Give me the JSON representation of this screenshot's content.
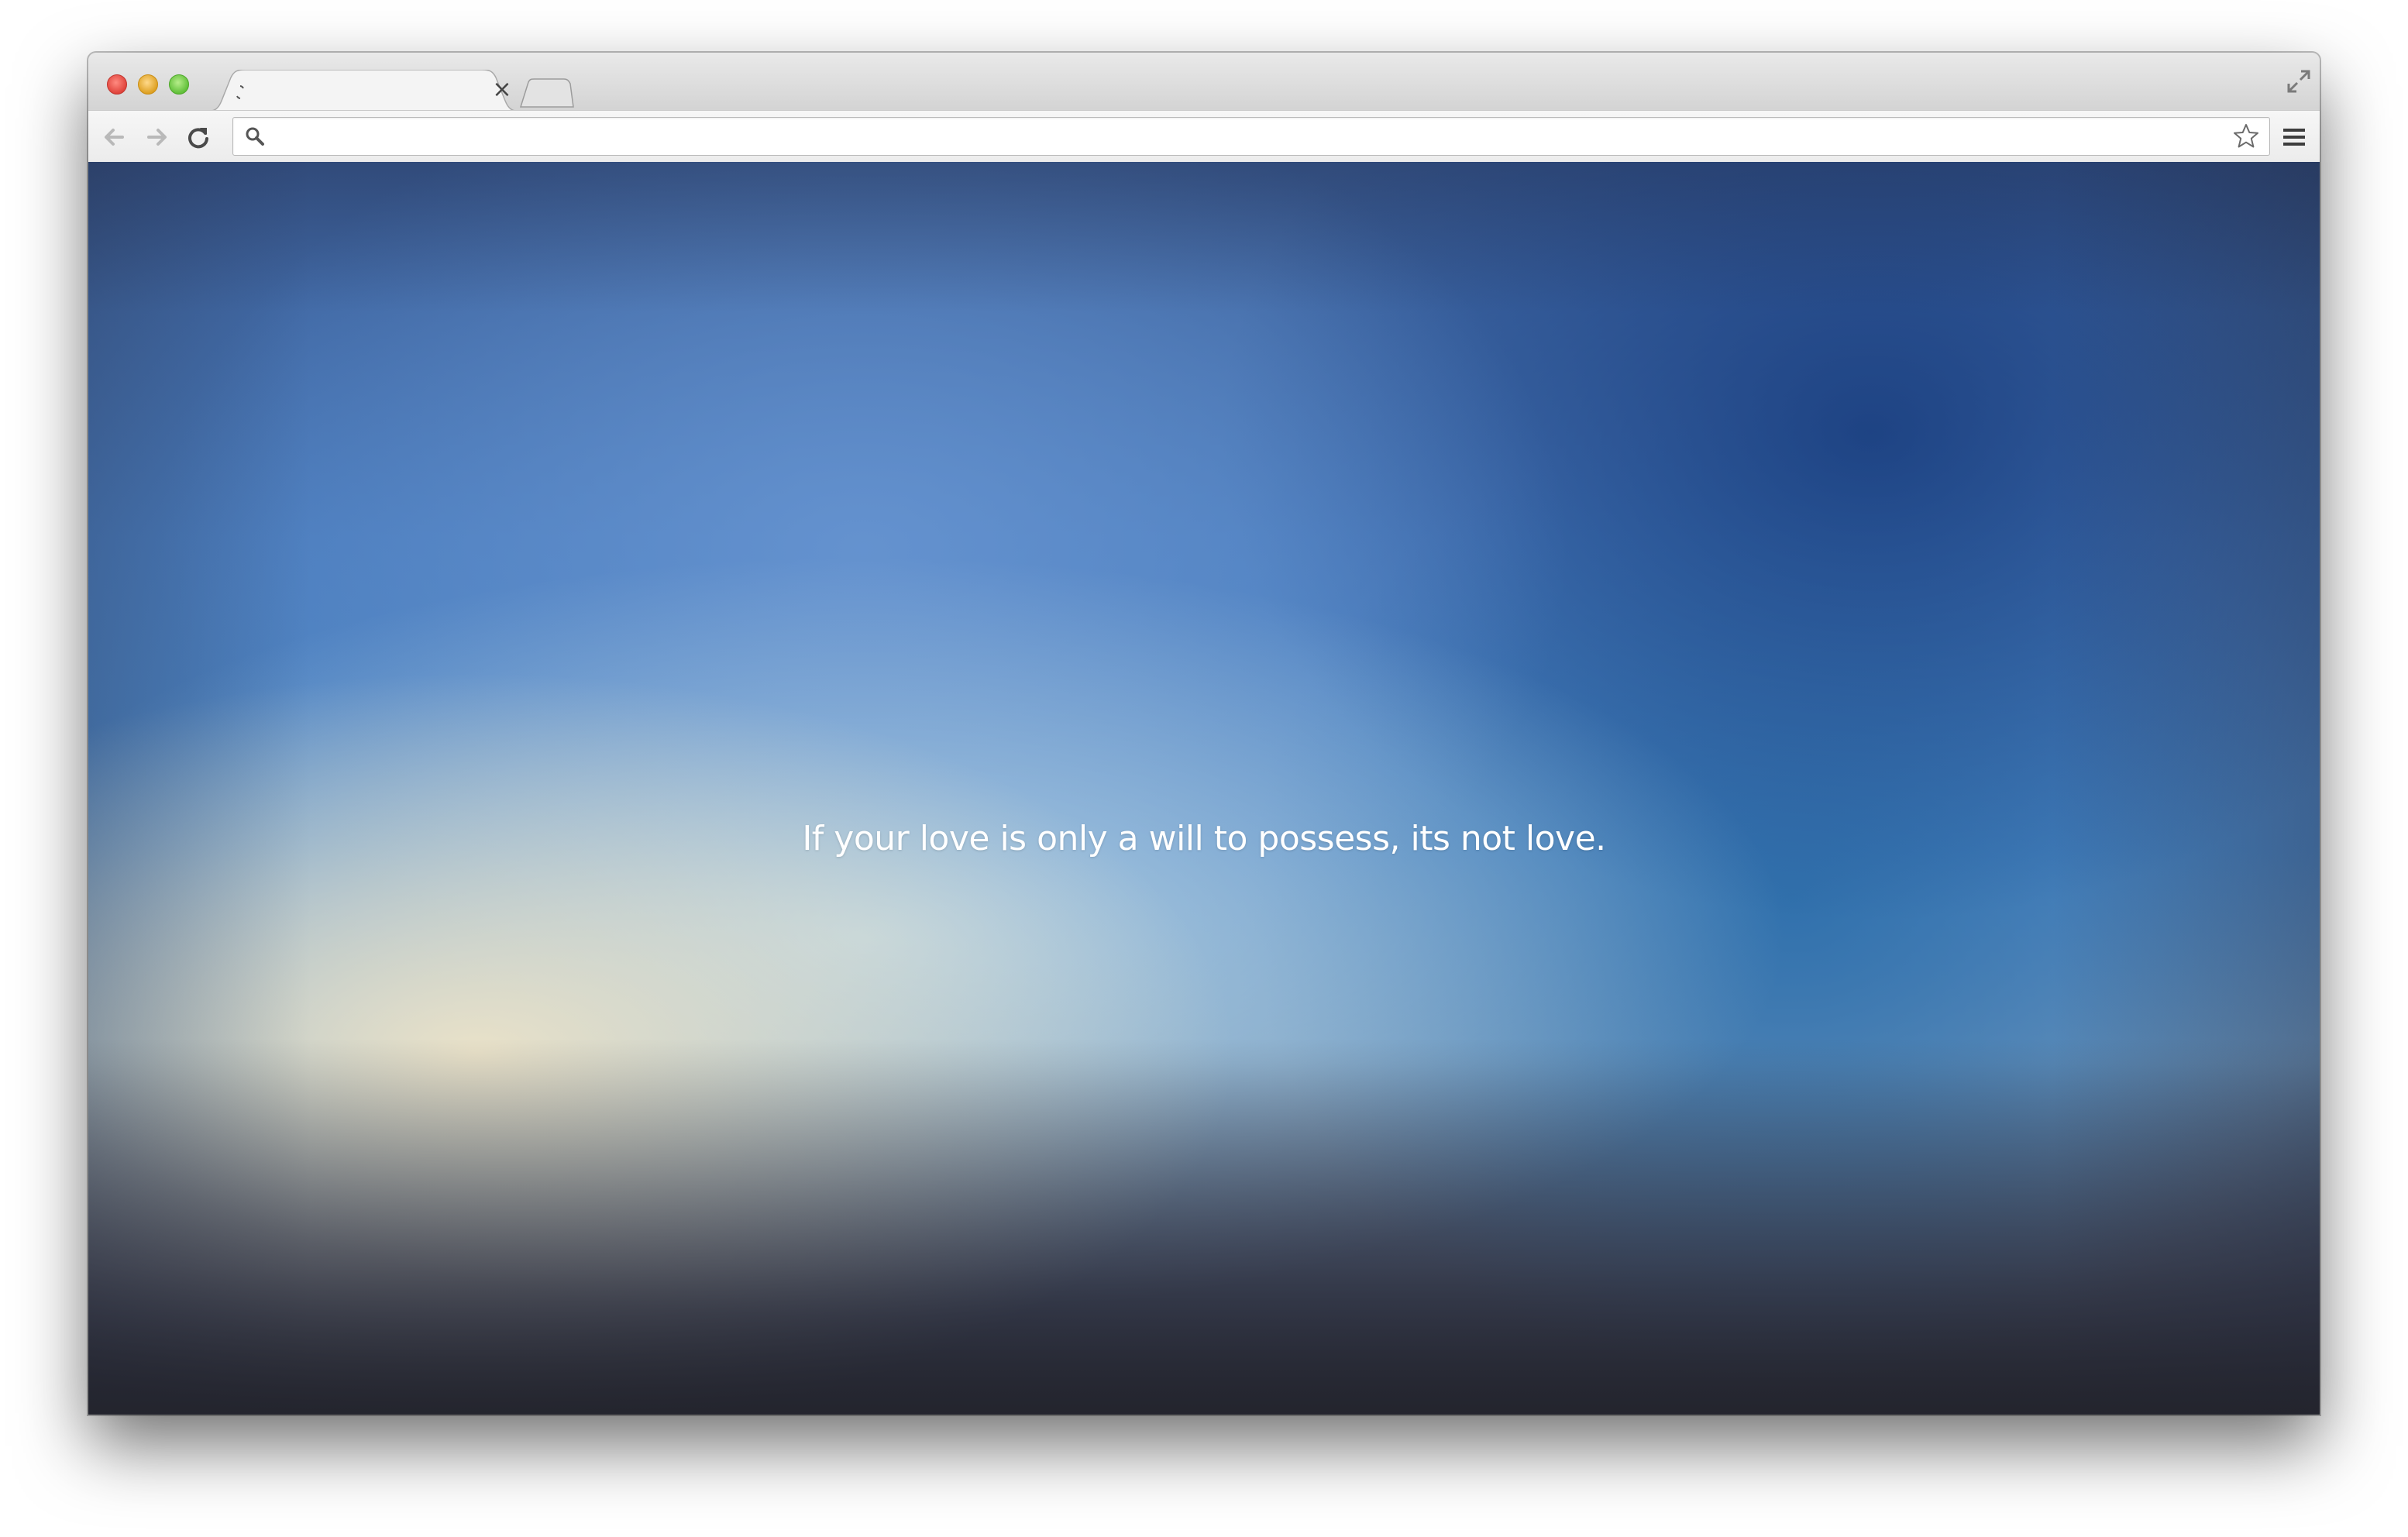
{
  "browser": {
    "tab": {
      "title": "",
      "loading": true
    },
    "omnibox": {
      "value": "",
      "placeholder": ""
    },
    "icons": {
      "close_window": "close-dot",
      "minimize_window": "minimize-dot",
      "zoom_window": "zoom-dot",
      "tab_close": "×",
      "back": "back-arrow-icon",
      "forward": "forward-arrow-icon",
      "reload": "reload-icon",
      "search": "search-icon",
      "bookmark": "star-icon",
      "menu": "hamburger-menu-icon",
      "fullscreen": "fullscreen-icon"
    }
  },
  "page": {
    "quote": "If your love is only a will to possess, its not love."
  },
  "colors": {
    "traffic_close": "#e0443c",
    "traffic_minimize": "#dea123",
    "traffic_zoom": "#61c03a",
    "quote_text": "#ffffff"
  }
}
